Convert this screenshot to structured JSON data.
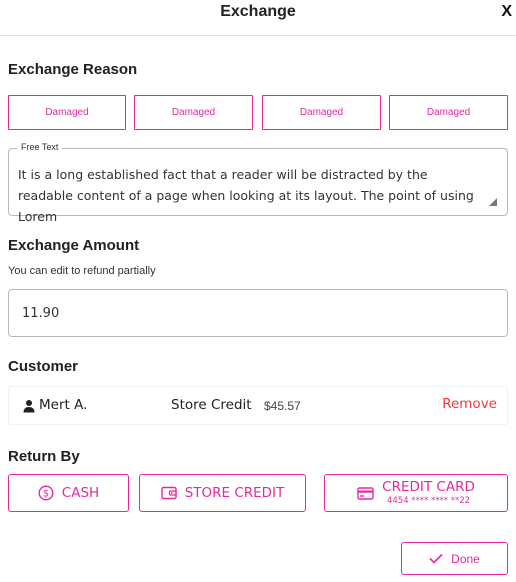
{
  "header": {
    "title": "Exchange",
    "close_label": "X"
  },
  "exchange_reason": {
    "title": "Exchange Reason",
    "options": [
      {
        "label": "Damaged"
      },
      {
        "label": "Damaged"
      },
      {
        "label": "Damaged"
      },
      {
        "label": "Damaged"
      }
    ],
    "free_text": {
      "legend": "Free Text",
      "value": "It is a long established fact that a reader will be distracted by the readable content of a page when looking at its layout. The point of using Lorem"
    }
  },
  "exchange_amount": {
    "title": "Exchange Amount",
    "hint": "You can edit to refund partially",
    "value": "11.90"
  },
  "customer": {
    "title": "Customer",
    "name": "Mert A.",
    "store_credit_label": "Store Credit",
    "store_credit_amount": "$45.57",
    "remove_label": "Remove"
  },
  "return_by": {
    "title": "Return By",
    "cash_label": "CASH",
    "store_credit_label": "STORE CREDIT",
    "credit_card_label": "CREDIT CARD",
    "credit_card_number": "4454 **** **** **22"
  },
  "done_label": "Done",
  "colors": {
    "accent": "#e6289b",
    "danger": "#ef3b3b",
    "border": "#b9b9b9"
  },
  "icons": [
    "close-icon",
    "resize-handle-icon",
    "person-icon",
    "dollar-circle-icon",
    "wallet-icon",
    "credit-card-icon",
    "check-icon"
  ]
}
